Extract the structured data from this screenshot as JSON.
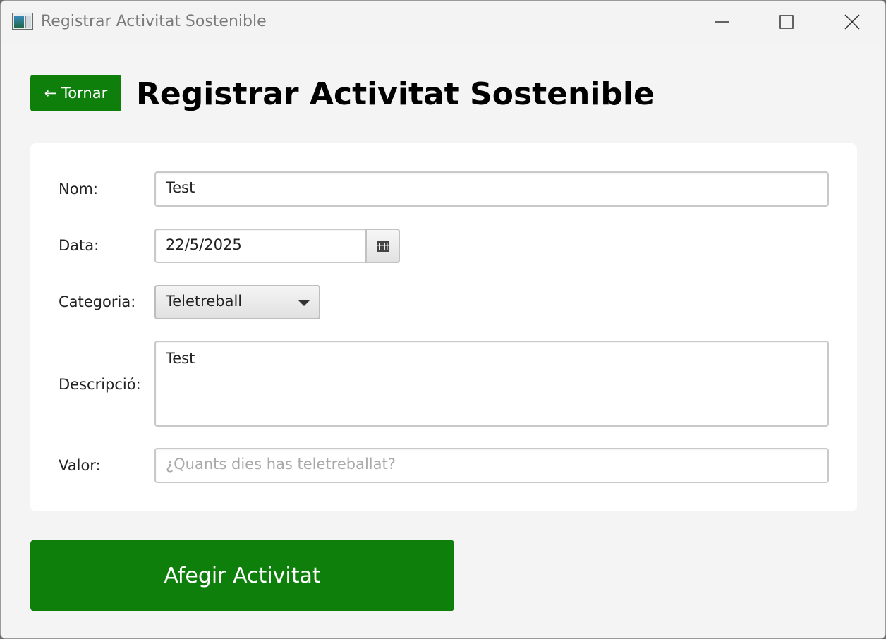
{
  "window": {
    "title": "Registrar Activitat Sostenible"
  },
  "header": {
    "back_label": "← Tornar",
    "title": "Registrar Activitat Sostenible"
  },
  "form": {
    "nom": {
      "label": "Nom:",
      "value": "Test"
    },
    "data": {
      "label": "Data:",
      "value": "22/5/2025",
      "icon": "calendar-icon"
    },
    "categoria": {
      "label": "Categoria:",
      "selected": "Teletreball"
    },
    "descripcio": {
      "label": "Descripció:",
      "value": "Test"
    },
    "valor": {
      "label": "Valor:",
      "value": "",
      "placeholder": "¿Quants dies has teletreballat?"
    }
  },
  "actions": {
    "submit_label": "Afegir Activitat"
  },
  "colors": {
    "accent": "#0e7f0b",
    "background": "#f4f4f4",
    "card": "#ffffff"
  }
}
